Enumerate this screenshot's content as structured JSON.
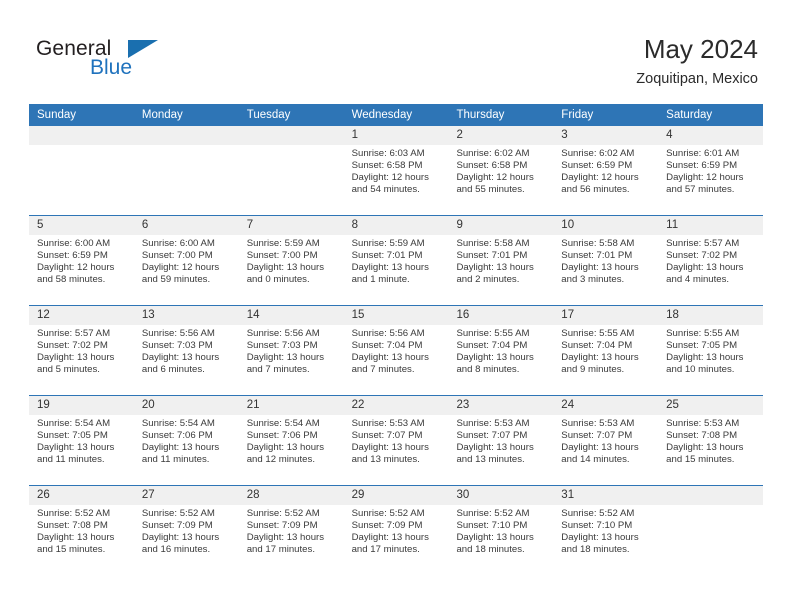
{
  "brand": {
    "name_part1": "General",
    "name_part2": "Blue",
    "logo_icon": "blue-triangle-icon"
  },
  "header": {
    "title": "May 2024",
    "subtitle": "Zoquitipan, Mexico"
  },
  "colors": {
    "header_blue": "#2e75b6",
    "brand_blue": "#1f72bd",
    "daynum_strip": "#f0f0f0",
    "text": "#333333"
  },
  "calendar": {
    "weekdays": [
      "Sunday",
      "Monday",
      "Tuesday",
      "Wednesday",
      "Thursday",
      "Friday",
      "Saturday"
    ],
    "weeks": [
      [
        {
          "day": "",
          "lines": []
        },
        {
          "day": "",
          "lines": []
        },
        {
          "day": "",
          "lines": []
        },
        {
          "day": "1",
          "lines": [
            "Sunrise: 6:03 AM",
            "Sunset: 6:58 PM",
            "Daylight: 12 hours",
            "and 54 minutes."
          ]
        },
        {
          "day": "2",
          "lines": [
            "Sunrise: 6:02 AM",
            "Sunset: 6:58 PM",
            "Daylight: 12 hours",
            "and 55 minutes."
          ]
        },
        {
          "day": "3",
          "lines": [
            "Sunrise: 6:02 AM",
            "Sunset: 6:59 PM",
            "Daylight: 12 hours",
            "and 56 minutes."
          ]
        },
        {
          "day": "4",
          "lines": [
            "Sunrise: 6:01 AM",
            "Sunset: 6:59 PM",
            "Daylight: 12 hours",
            "and 57 minutes."
          ]
        }
      ],
      [
        {
          "day": "5",
          "lines": [
            "Sunrise: 6:00 AM",
            "Sunset: 6:59 PM",
            "Daylight: 12 hours",
            "and 58 minutes."
          ]
        },
        {
          "day": "6",
          "lines": [
            "Sunrise: 6:00 AM",
            "Sunset: 7:00 PM",
            "Daylight: 12 hours",
            "and 59 minutes."
          ]
        },
        {
          "day": "7",
          "lines": [
            "Sunrise: 5:59 AM",
            "Sunset: 7:00 PM",
            "Daylight: 13 hours",
            "and 0 minutes."
          ]
        },
        {
          "day": "8",
          "lines": [
            "Sunrise: 5:59 AM",
            "Sunset: 7:01 PM",
            "Daylight: 13 hours",
            "and 1 minute."
          ]
        },
        {
          "day": "9",
          "lines": [
            "Sunrise: 5:58 AM",
            "Sunset: 7:01 PM",
            "Daylight: 13 hours",
            "and 2 minutes."
          ]
        },
        {
          "day": "10",
          "lines": [
            "Sunrise: 5:58 AM",
            "Sunset: 7:01 PM",
            "Daylight: 13 hours",
            "and 3 minutes."
          ]
        },
        {
          "day": "11",
          "lines": [
            "Sunrise: 5:57 AM",
            "Sunset: 7:02 PM",
            "Daylight: 13 hours",
            "and 4 minutes."
          ]
        }
      ],
      [
        {
          "day": "12",
          "lines": [
            "Sunrise: 5:57 AM",
            "Sunset: 7:02 PM",
            "Daylight: 13 hours",
            "and 5 minutes."
          ]
        },
        {
          "day": "13",
          "lines": [
            "Sunrise: 5:56 AM",
            "Sunset: 7:03 PM",
            "Daylight: 13 hours",
            "and 6 minutes."
          ]
        },
        {
          "day": "14",
          "lines": [
            "Sunrise: 5:56 AM",
            "Sunset: 7:03 PM",
            "Daylight: 13 hours",
            "and 7 minutes."
          ]
        },
        {
          "day": "15",
          "lines": [
            "Sunrise: 5:56 AM",
            "Sunset: 7:04 PM",
            "Daylight: 13 hours",
            "and 7 minutes."
          ]
        },
        {
          "day": "16",
          "lines": [
            "Sunrise: 5:55 AM",
            "Sunset: 7:04 PM",
            "Daylight: 13 hours",
            "and 8 minutes."
          ]
        },
        {
          "day": "17",
          "lines": [
            "Sunrise: 5:55 AM",
            "Sunset: 7:04 PM",
            "Daylight: 13 hours",
            "and 9 minutes."
          ]
        },
        {
          "day": "18",
          "lines": [
            "Sunrise: 5:55 AM",
            "Sunset: 7:05 PM",
            "Daylight: 13 hours",
            "and 10 minutes."
          ]
        }
      ],
      [
        {
          "day": "19",
          "lines": [
            "Sunrise: 5:54 AM",
            "Sunset: 7:05 PM",
            "Daylight: 13 hours",
            "and 11 minutes."
          ]
        },
        {
          "day": "20",
          "lines": [
            "Sunrise: 5:54 AM",
            "Sunset: 7:06 PM",
            "Daylight: 13 hours",
            "and 11 minutes."
          ]
        },
        {
          "day": "21",
          "lines": [
            "Sunrise: 5:54 AM",
            "Sunset: 7:06 PM",
            "Daylight: 13 hours",
            "and 12 minutes."
          ]
        },
        {
          "day": "22",
          "lines": [
            "Sunrise: 5:53 AM",
            "Sunset: 7:07 PM",
            "Daylight: 13 hours",
            "and 13 minutes."
          ]
        },
        {
          "day": "23",
          "lines": [
            "Sunrise: 5:53 AM",
            "Sunset: 7:07 PM",
            "Daylight: 13 hours",
            "and 13 minutes."
          ]
        },
        {
          "day": "24",
          "lines": [
            "Sunrise: 5:53 AM",
            "Sunset: 7:07 PM",
            "Daylight: 13 hours",
            "and 14 minutes."
          ]
        },
        {
          "day": "25",
          "lines": [
            "Sunrise: 5:53 AM",
            "Sunset: 7:08 PM",
            "Daylight: 13 hours",
            "and 15 minutes."
          ]
        }
      ],
      [
        {
          "day": "26",
          "lines": [
            "Sunrise: 5:52 AM",
            "Sunset: 7:08 PM",
            "Daylight: 13 hours",
            "and 15 minutes."
          ]
        },
        {
          "day": "27",
          "lines": [
            "Sunrise: 5:52 AM",
            "Sunset: 7:09 PM",
            "Daylight: 13 hours",
            "and 16 minutes."
          ]
        },
        {
          "day": "28",
          "lines": [
            "Sunrise: 5:52 AM",
            "Sunset: 7:09 PM",
            "Daylight: 13 hours",
            "and 17 minutes."
          ]
        },
        {
          "day": "29",
          "lines": [
            "Sunrise: 5:52 AM",
            "Sunset: 7:09 PM",
            "Daylight: 13 hours",
            "and 17 minutes."
          ]
        },
        {
          "day": "30",
          "lines": [
            "Sunrise: 5:52 AM",
            "Sunset: 7:10 PM",
            "Daylight: 13 hours",
            "and 18 minutes."
          ]
        },
        {
          "day": "31",
          "lines": [
            "Sunrise: 5:52 AM",
            "Sunset: 7:10 PM",
            "Daylight: 13 hours",
            "and 18 minutes."
          ]
        },
        {
          "day": "",
          "lines": []
        }
      ]
    ]
  }
}
